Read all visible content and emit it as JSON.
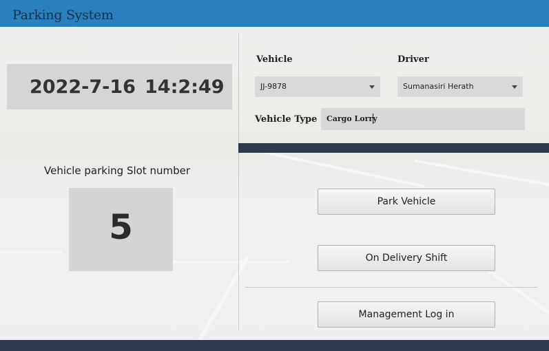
{
  "window": {
    "title": "Parking System"
  },
  "clock": {
    "date": "2022-7-16",
    "time": "14:2:49"
  },
  "slot": {
    "label": "Vehicle parking Slot number",
    "number": "5"
  },
  "form": {
    "vehicle_label": "Vehicle",
    "vehicle_value": "JJ-9878",
    "driver_label": "Driver",
    "driver_value": "Sumanasiri Herath",
    "type_label": "Vehicle Type",
    "type_value": "Cargo Lorry"
  },
  "buttons": {
    "park": "Park Vehicle",
    "delivery": "On Delivery Shift",
    "login": "Management Log in"
  },
  "colors": {
    "titlebar": "#2a80bf",
    "darkbar": "#2c3a4c"
  }
}
